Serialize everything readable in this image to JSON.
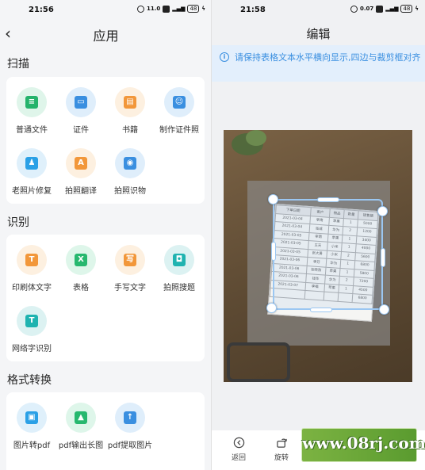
{
  "left": {
    "status": {
      "time": "21:56",
      "net": "11.0",
      "battery": "48"
    },
    "title": "应用",
    "sections": [
      {
        "title": "扫描",
        "items": [
          {
            "label": "普通文件",
            "icon": "document-icon",
            "glyph": "≡",
            "color": "green"
          },
          {
            "label": "证件",
            "icon": "id-card-icon",
            "glyph": "▭",
            "color": "blue"
          },
          {
            "label": "书籍",
            "icon": "book-icon",
            "glyph": "▤",
            "color": "orange"
          },
          {
            "label": "制作证件照",
            "icon": "id-photo-icon",
            "glyph": "☺",
            "color": "blue"
          },
          {
            "label": "老照片修复",
            "icon": "photo-repair-icon",
            "glyph": "♟",
            "color": "cyan"
          },
          {
            "label": "拍照翻译",
            "icon": "translate-icon",
            "glyph": "A",
            "color": "orange"
          },
          {
            "label": "拍照识物",
            "icon": "object-recognition-icon",
            "glyph": "◉",
            "color": "blue"
          }
        ]
      },
      {
        "title": "识别",
        "items": [
          {
            "label": "印刷体文字",
            "icon": "print-text-icon",
            "glyph": "T",
            "color": "orange"
          },
          {
            "label": "表格",
            "icon": "table-icon",
            "glyph": "X",
            "color": "green2"
          },
          {
            "label": "手写文字",
            "icon": "handwriting-icon",
            "glyph": "写",
            "color": "orange"
          },
          {
            "label": "拍照搜题",
            "icon": "camera-search-icon",
            "glyph": "◘",
            "color": "teal"
          },
          {
            "label": "网络字识别",
            "icon": "web-text-icon",
            "glyph": "T",
            "color": "teal"
          }
        ]
      },
      {
        "title": "格式转换",
        "items": [
          {
            "label": "图片转pdf",
            "icon": "image-to-pdf-icon",
            "glyph": "▣",
            "color": "cyan"
          },
          {
            "label": "pdf输出长图",
            "icon": "pdf-long-image-icon",
            "glyph": "▲",
            "color": "green2"
          },
          {
            "label": "pdf提取图片",
            "icon": "pdf-extract-image-icon",
            "glyph": "↑",
            "color": "blue"
          }
        ]
      }
    ]
  },
  "right": {
    "status": {
      "time": "21:58",
      "net": "0.07"
    },
    "title": "编辑",
    "tip": "请保持表格文本水平横向显示,四边与裁剪框对齐",
    "bottom": {
      "back_label": "返回",
      "rotate_label": "旋转"
    },
    "document_table": {
      "header": [
        "下单日期",
        "客户",
        "物品",
        "数量",
        "销售额"
      ],
      "rows": [
        [
          "2021-03-04",
          "李南",
          "苹果",
          "1",
          "5000"
        ],
        [
          "2021-03-04",
          "张成",
          "华为",
          "2",
          "1200"
        ],
        [
          "2021-03-05",
          "李南",
          "苹果",
          "1",
          "3400"
        ],
        [
          "2021-03-05",
          "王天",
          "小米",
          "1",
          "4000"
        ],
        [
          "2021-03-05",
          "张大勇",
          "小米",
          "2",
          "5600"
        ],
        [
          "2021-03-06",
          "李芬",
          "华为",
          "1",
          "6800"
        ],
        [
          "2021-03-06",
          "张晓燕",
          "苹果",
          "1",
          "5800"
        ],
        [
          "2021-03-06",
          "钱华",
          "华为",
          "2",
          "7200"
        ],
        [
          "2021-03-07",
          "李福",
          "苹果",
          "1",
          "4500"
        ],
        [
          "",
          "",
          "",
          "",
          "6800"
        ]
      ]
    }
  },
  "watermark": "www.08rj.com"
}
